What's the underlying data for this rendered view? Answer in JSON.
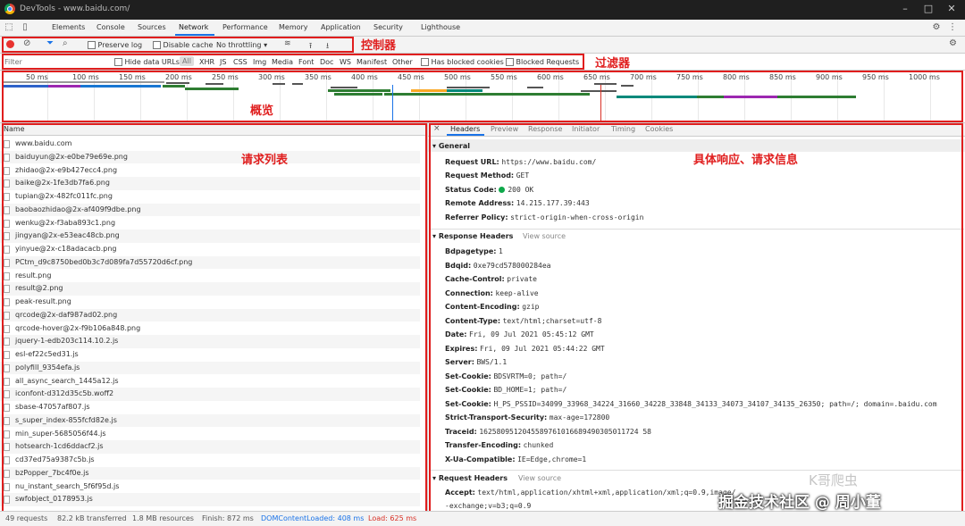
{
  "window": {
    "title": "DevTools - www.baidu.com/"
  },
  "tabs": [
    "Elements",
    "Console",
    "Sources",
    "Network",
    "Performance",
    "Memory",
    "Application",
    "Security",
    "Lighthouse"
  ],
  "active_tab": "Network",
  "controls": {
    "preserve_log": "Preserve log",
    "disable_cache": "Disable cache",
    "throttling": "No throttling",
    "annotation": "控制器"
  },
  "filter": {
    "placeholder": "Filter",
    "hide_data_urls": "Hide data URLs",
    "types": [
      "All",
      "XHR",
      "JS",
      "CSS",
      "Img",
      "Media",
      "Font",
      "Doc",
      "WS",
      "Manifest",
      "Other"
    ],
    "has_blocked_cookies": "Has blocked cookies",
    "blocked_requests": "Blocked Requests",
    "annotation": "过滤器"
  },
  "overview": {
    "ticks": [
      "50 ms",
      "100 ms",
      "150 ms",
      "200 ms",
      "250 ms",
      "300 ms",
      "350 ms",
      "400 ms",
      "450 ms",
      "500 ms",
      "550 ms",
      "600 ms",
      "650 ms",
      "700 ms",
      "750 ms",
      "800 ms",
      "850 ms",
      "900 ms",
      "950 ms",
      "1000 ms"
    ],
    "annotation": "概览"
  },
  "request_list": {
    "header": "Name",
    "annotation": "请求列表",
    "items": [
      "www.baidu.com",
      "baiduyun@2x-e0be79e69e.png",
      "zhidao@2x-e9b427ecc4.png",
      "baike@2x-1fe3db7fa6.png",
      "tupian@2x-482fc011fc.png",
      "baobaozhidao@2x-af409f9dbe.png",
      "wenku@2x-f3aba893c1.png",
      "jingyan@2x-e53eac48cb.png",
      "yinyue@2x-c18adacacb.png",
      "PCtm_d9c8750bed0b3c7d089fa7d55720d6cf.png",
      "result.png",
      "result@2.png",
      "peak-result.png",
      "qrcode@2x-daf987ad02.png",
      "qrcode-hover@2x-f9b106a848.png",
      "jquery-1-edb203c114.10.2.js",
      "esl-ef22c5ed31.js",
      "polyfill_9354efa.js",
      "all_async_search_1445a12.js",
      "iconfont-d312d35c5b.woff2",
      "sbase-47057af807.js",
      "s_super_index-855fcfd82e.js",
      "min_super-5685056f44.js",
      "hotsearch-1cd6ddacf2.js",
      "cd37ed75a9387c5b.js",
      "bzPopper_7bc4f0e.js",
      "nu_instant_search_5f6f95d.js",
      "swfobject_0178953.js"
    ]
  },
  "detail": {
    "tabs": [
      "Headers",
      "Preview",
      "Response",
      "Initiator",
      "Timing",
      "Cookies"
    ],
    "annotation": "具体响应、请求信息",
    "general": {
      "title": "General",
      "items": [
        {
          "k": "Request URL:",
          "v": "https://www.baidu.com/"
        },
        {
          "k": "Request Method:",
          "v": "GET"
        },
        {
          "k": "Status Code:",
          "v": "200 OK"
        },
        {
          "k": "Remote Address:",
          "v": "14.215.177.39:443"
        },
        {
          "k": "Referrer Policy:",
          "v": "strict-origin-when-cross-origin"
        }
      ]
    },
    "response_headers": {
      "title": "Response Headers",
      "view_source": "View source",
      "items": [
        {
          "k": "Bdpagetype:",
          "v": "1"
        },
        {
          "k": "Bdqid:",
          "v": "0xe79cd578000284ea"
        },
        {
          "k": "Cache-Control:",
          "v": "private"
        },
        {
          "k": "Connection:",
          "v": "keep-alive"
        },
        {
          "k": "Content-Encoding:",
          "v": "gzip"
        },
        {
          "k": "Content-Type:",
          "v": "text/html;charset=utf-8"
        },
        {
          "k": "Date:",
          "v": "Fri, 09 Jul 2021 05:45:12 GMT"
        },
        {
          "k": "Expires:",
          "v": "Fri, 09 Jul 2021 05:44:22 GMT"
        },
        {
          "k": "Server:",
          "v": "BWS/1.1"
        },
        {
          "k": "Set-Cookie:",
          "v": "BDSVRTM=0; path=/"
        },
        {
          "k": "Set-Cookie:",
          "v": "BD_HOME=1; path=/"
        },
        {
          "k": "Set-Cookie:",
          "v": "H_PS_PSSID=34099_33968_34224_31660_34228_33848_34133_34073_34107_34135_26350; path=/; domain=.baidu.com"
        },
        {
          "k": "Strict-Transport-Security:",
          "v": "max-age=172800"
        },
        {
          "k": "Traceid:",
          "v": "1625809512045589761016689490305011724 58"
        },
        {
          "k": "Transfer-Encoding:",
          "v": "chunked"
        },
        {
          "k": "X-Ua-Compatible:",
          "v": "IE=Edge,chrome=1"
        }
      ]
    },
    "request_headers": {
      "title": "Request Headers",
      "view_source": "View source",
      "accept_k": "Accept:",
      "accept_v": "text/html,application/xhtml+xml,application/xml;q=0.9,image/",
      "accept_v2": "-exchange;v=b3;q=0.9"
    }
  },
  "status": {
    "requests": "49 requests",
    "transferred": "82.2 kB transferred",
    "resources": "1.8 MB resources",
    "finish": "Finish: 872 ms",
    "dcl": "DOMContentLoaded: 408 ms",
    "load": "Load: 625 ms"
  },
  "watermark": {
    "line1": "K哥爬虫",
    "line2": "掘金技术社区 @ 周小董"
  },
  "colors": {
    "annotation": "#e01e1e",
    "record": "#e8322f",
    "status_ok": "#0ea84a",
    "dcl": "#1a73e8",
    "load": "#d93025"
  }
}
